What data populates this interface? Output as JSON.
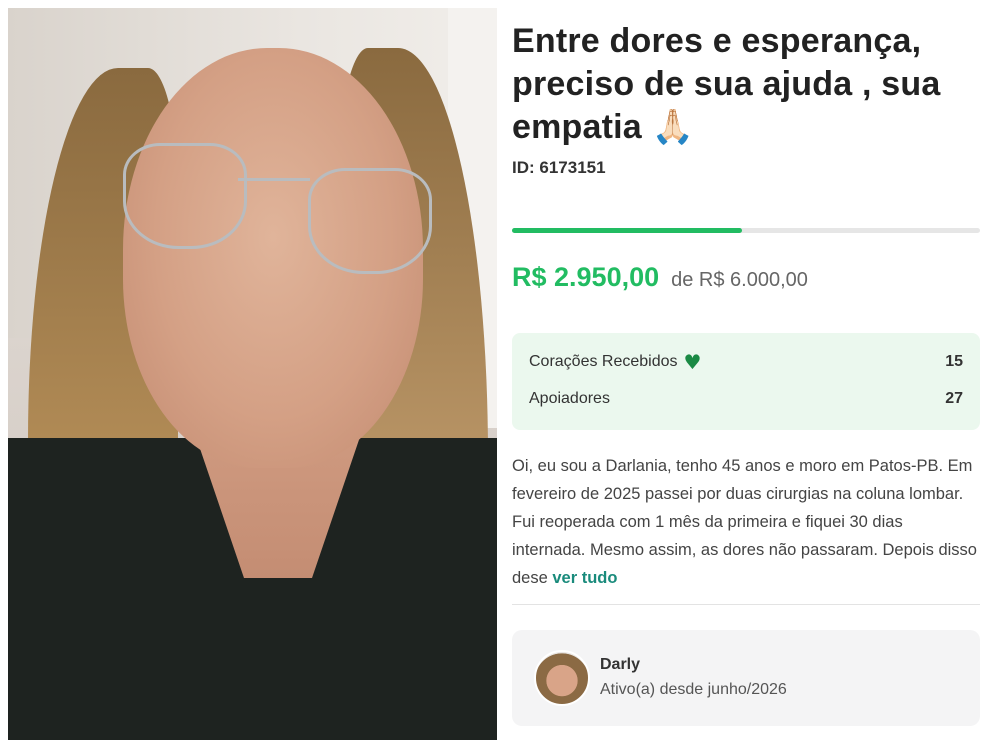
{
  "campaign": {
    "title": "Entre dores e esperança, preciso de sua ajuda , sua empatia",
    "title_emoji": "🙏🏻",
    "id_label": "ID: 6173151",
    "progress_fraction": 0.4917,
    "raised": "R$ 2.950,00",
    "goal": "de R$ 6.000,00"
  },
  "stats": {
    "hearts_label": "Corações Recebidos",
    "hearts_icon": "green-heart-icon",
    "hearts_value": "15",
    "supporters_label": "Apoiadores",
    "supporters_value": "27"
  },
  "description": {
    "text": "Oi, eu sou a Darlania, tenho 45 anos e moro em Patos-PB. Em fevereiro de 2025 passei por duas cirurgias na coluna lombar. Fui reoperada com 1 mês da primeira e fiquei 30 dias internada. Mesmo assim, as dores não passaram. Depois disso dese",
    "more_link": "ver tudo"
  },
  "owner": {
    "name": "Darly",
    "active_since": "Ativo(a) desde junho/2026"
  },
  "colors": {
    "accent_green": "#22bc62",
    "stats_bg": "#ebf8ee",
    "link": "#1a8b7c"
  }
}
